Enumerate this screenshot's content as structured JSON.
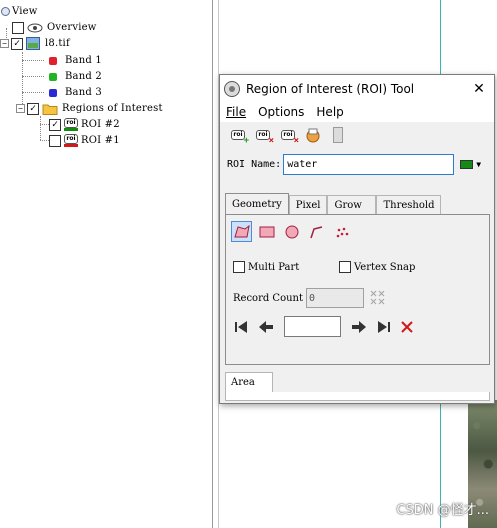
{
  "tree": {
    "view_label": "View",
    "overview_label": "Overview",
    "file_label": "l8.tif",
    "bands": [
      {
        "label": "Band 1",
        "color": "#e0202a"
      },
      {
        "label": "Band 2",
        "color": "#22b322"
      },
      {
        "label": "Band 3",
        "color": "#2a2ad4"
      }
    ],
    "roi_group_label": "Regions of Interest",
    "rois": [
      {
        "label": "ROI #2",
        "checked": true,
        "color": "#138a13"
      },
      {
        "label": "ROI #1",
        "checked": false,
        "color": "#d11919"
      }
    ]
  },
  "dialog": {
    "title": "Region of Interest (ROI) Tool",
    "menu": {
      "file": "File",
      "options": "Options",
      "help": "Help"
    },
    "toolbar_icons": [
      "new-roi-icon",
      "delete-roi-icon",
      "delete-all-roi-icon",
      "goto-roi-icon",
      "disabled-tool-icon"
    ],
    "roi_name_label": "ROI Name:",
    "roi_name_value": "water",
    "roi_color": "#138a13",
    "tabs": [
      "Geometry",
      "Pixel",
      "Grow",
      "Threshold"
    ],
    "active_tab": "Geometry",
    "geometry_tools": [
      "polygon-icon",
      "rectangle-icon",
      "ellipse-icon",
      "polyline-icon",
      "point-icon"
    ],
    "multi_part_label": "Multi Part",
    "vertex_snap_label": "Vertex Snap",
    "record_count_label": "Record Count",
    "record_count_value": "0",
    "area_tab_label": "Area"
  },
  "watermark": "CSDN @怪才..."
}
